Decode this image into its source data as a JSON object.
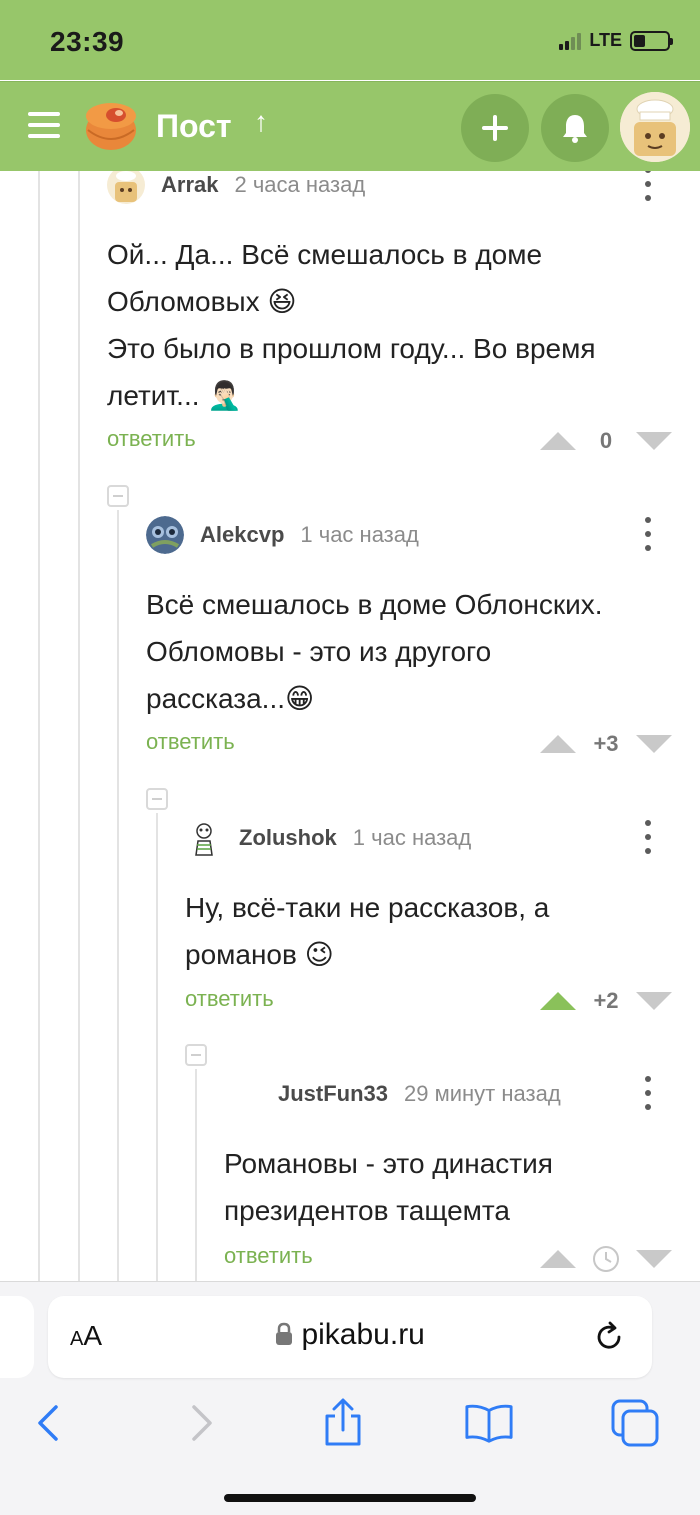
{
  "status_bar": {
    "time": "23:39",
    "network": "LTE",
    "signal_bars": 2,
    "battery_level": 0.35
  },
  "header": {
    "title": "Пост",
    "sort_arrow": "↑",
    "menu_icon": "hamburger-icon",
    "logo_icon": "pikabu-logo",
    "add_icon": "plus-icon",
    "notifications_icon": "bell-icon",
    "avatar_icon": "user-avatar"
  },
  "comments": [
    {
      "author": "Arrak",
      "time": "2 часа назад",
      "lines": [
        "Ой... Да... Всё смешалось в доме",
        "Обломовых 😆",
        "Это было в прошлом году... Во время",
        "летит... 🤦🏻‍♂️"
      ],
      "reply_label": "ответить",
      "score": "0",
      "upvoted": false
    },
    {
      "author": "Alekcvp",
      "time": "1 час назад",
      "lines": [
        "Всё смешалось в доме Облонских.",
        "Обломовы - это из другого",
        "рассказа...😁"
      ],
      "reply_label": "ответить",
      "score": "+3",
      "upvoted": false
    },
    {
      "author": "Zolushok",
      "time": "1 час назад",
      "lines": [
        "Ну, всё-таки не рассказов, а",
        "романов 😉"
      ],
      "reply_label": "ответить",
      "score": "+2",
      "upvoted": true
    },
    {
      "author": "JustFun33",
      "time": "29 минут назад",
      "lines": [
        "Романовы - это династия",
        "президентов тащемта"
      ],
      "reply_label": "ответить",
      "score": "",
      "pending_icon": "clock-icon",
      "upvoted": false
    }
  ],
  "browser": {
    "text_size_label_small": "A",
    "text_size_label_large": "A",
    "url": "pikabu.ru",
    "lock_icon": "lock-icon",
    "reload_icon": "reload-icon",
    "toolbar_icons": [
      "back-icon",
      "forward-icon",
      "share-icon",
      "bookmarks-icon",
      "tabs-icon"
    ]
  },
  "colors": {
    "brand_green": "#97c66a",
    "reply_green": "#7bb251",
    "upvote_active": "#8ac15a",
    "ios_blue": "#2f7cf6"
  }
}
